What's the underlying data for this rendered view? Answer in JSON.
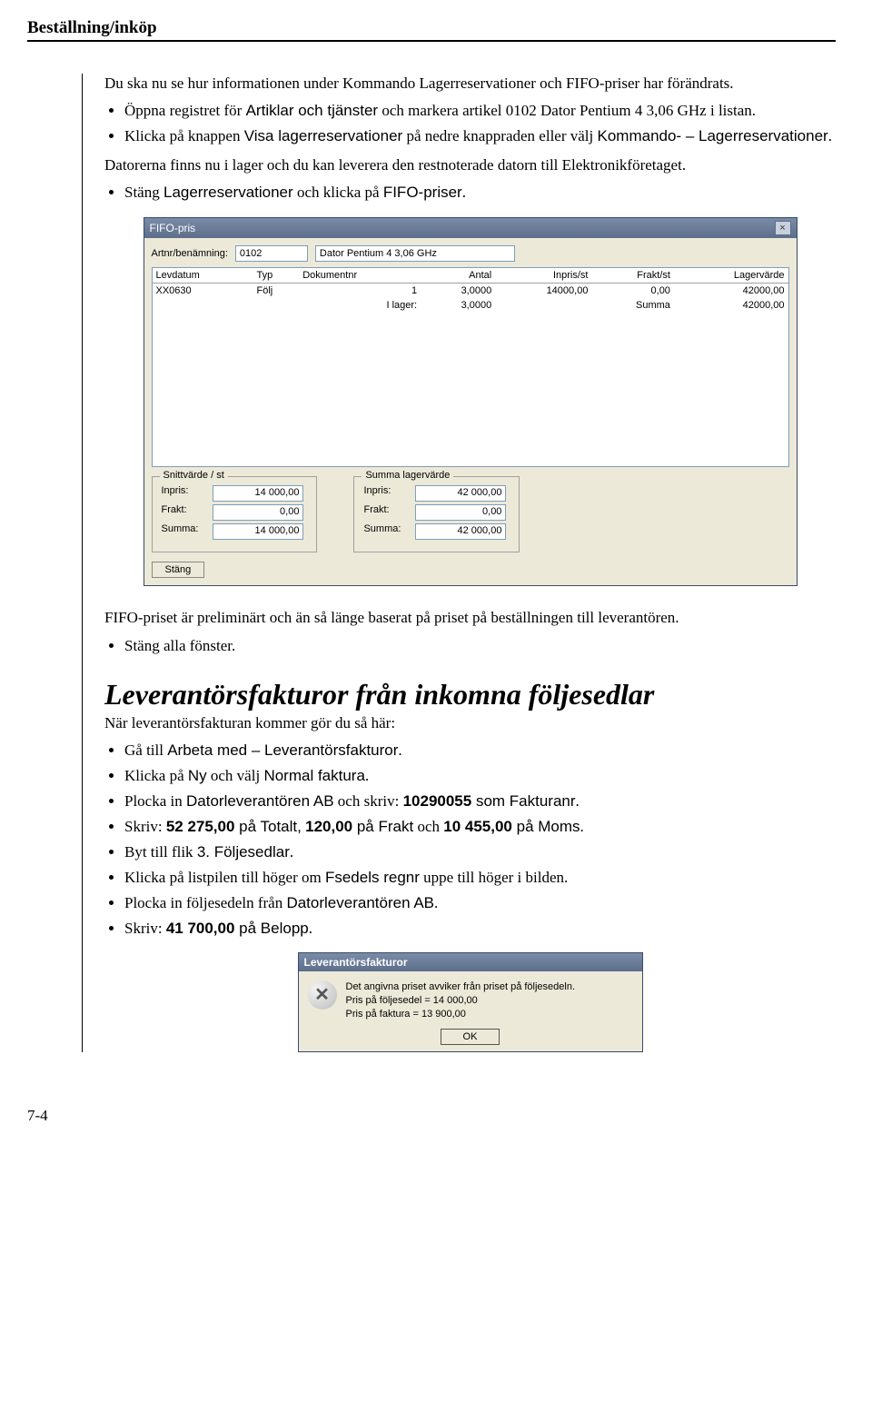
{
  "header": {
    "title": "Beställning/inköp"
  },
  "intro_para": "Du ska nu se hur informationen under Kommando Lagerreservationer och FIFO-priser har förändrats.",
  "bullets1": [
    {
      "pre": "Öppna registret för ",
      "sans": "Artiklar och tjänster",
      "post": " och markera artikel 0102 Dator Pentium 4 3,06 GHz i listan."
    },
    {
      "pre": "Klicka på knappen ",
      "sans": "Visa lagerreservationer",
      "post": " på nedre knappraden eller välj ",
      "sans2": "Kommando- – Lagerreservationer",
      "post2": "."
    }
  ],
  "mid_para": "Datorerna finns nu i lager och du kan leverera den restnoterade datorn till Elektronikföretaget.",
  "bullet_mid": {
    "pre": "Stäng ",
    "sans": "Lagerreservationer",
    "post": " och klicka på ",
    "sans2": "FIFO-priser",
    "post2": "."
  },
  "fifo": {
    "title": "FIFO-pris",
    "artnr_label": "Artnr/benämning:",
    "artnr_value": "0102",
    "artname_value": "Dator Pentium 4 3,06 GHz",
    "headers": [
      "Levdatum",
      "Typ",
      "Dokumentnr",
      "Antal",
      "Inpris/st",
      "Frakt/st",
      "Lagervärde"
    ],
    "rows": [
      [
        "XX0630",
        "Följ",
        "1",
        "3,0000",
        "14000,00",
        "0,00",
        "42000,00"
      ],
      [
        "",
        "",
        "I lager:",
        "3,0000",
        "",
        "Summa",
        "42000,00"
      ]
    ],
    "groups": {
      "left": {
        "legend": "Snittvärde / st",
        "inpris_label": "Inpris:",
        "inpris": "14 000,00",
        "frakt_label": "Frakt:",
        "frakt": "0,00",
        "summa_label": "Summa:",
        "summa": "14 000,00"
      },
      "right": {
        "legend": "Summa lagervärde",
        "inpris_label": "Inpris:",
        "inpris": "42 000,00",
        "frakt_label": "Frakt:",
        "frakt": "0,00",
        "summa_label": "Summa:",
        "summa": "42 000,00"
      }
    },
    "close_btn": "Stäng"
  },
  "after_fifo_para": "FIFO-priset är preliminärt och än så länge baserat på priset på beställningen till leverantören.",
  "bullet_after_fifo": "Stäng alla fönster.",
  "section_heading": "Leverantörsfakturor från inkomna följesedlar",
  "section_lead": "När leverantörsfakturan kommer gör du så här:",
  "bullets2": [
    {
      "pre": "Gå till ",
      "sans": "Arbeta med – Leverantörsfakturor",
      "post": "."
    },
    {
      "pre": "Klicka på ",
      "sans": "Ny",
      "mid": " och välj ",
      "sans2": "Normal faktura",
      "post": "."
    },
    {
      "pre": "Plocka in ",
      "sans": "Datorleverantören AB",
      "mid": " och skriv: ",
      "bold": "10290055",
      "post_sans": " som Fakturanr",
      "post": "."
    },
    {
      "plain": "Skriv: ",
      "bold1": "52 275,00",
      "mid1_sans": " på Totalt,",
      "sp1": " ",
      "bold2": "120,00",
      "mid2_sans": " på Frakt",
      "mid2b": " och ",
      "bold3": "10 455,00",
      "mid3_sans": " på Moms",
      "end": "."
    },
    {
      "pre": "Byt till flik ",
      "sans": "3. Följesedlar",
      "post": "."
    },
    {
      "plain": "Klicka på listpilen till höger om ",
      "sans": "Fsedels regnr",
      "post": " uppe till höger i bilden."
    },
    {
      "plain": "Plocka in följesedeln från ",
      "sans": "Datorleverantören AB",
      "post": "."
    },
    {
      "plain": "Skriv: ",
      "bold1": "41 700,00",
      "mid1_sans": " på Belopp",
      "end": "."
    }
  ],
  "dialog": {
    "title": "Leverantörsfakturor",
    "line1": "Det angivna priset avviker från priset på följesedeln.",
    "line2": "Pris på följesedel = 14 000,00",
    "line3": "Pris på faktura = 13 900,00",
    "ok": "OK"
  },
  "page_number": "7-4"
}
